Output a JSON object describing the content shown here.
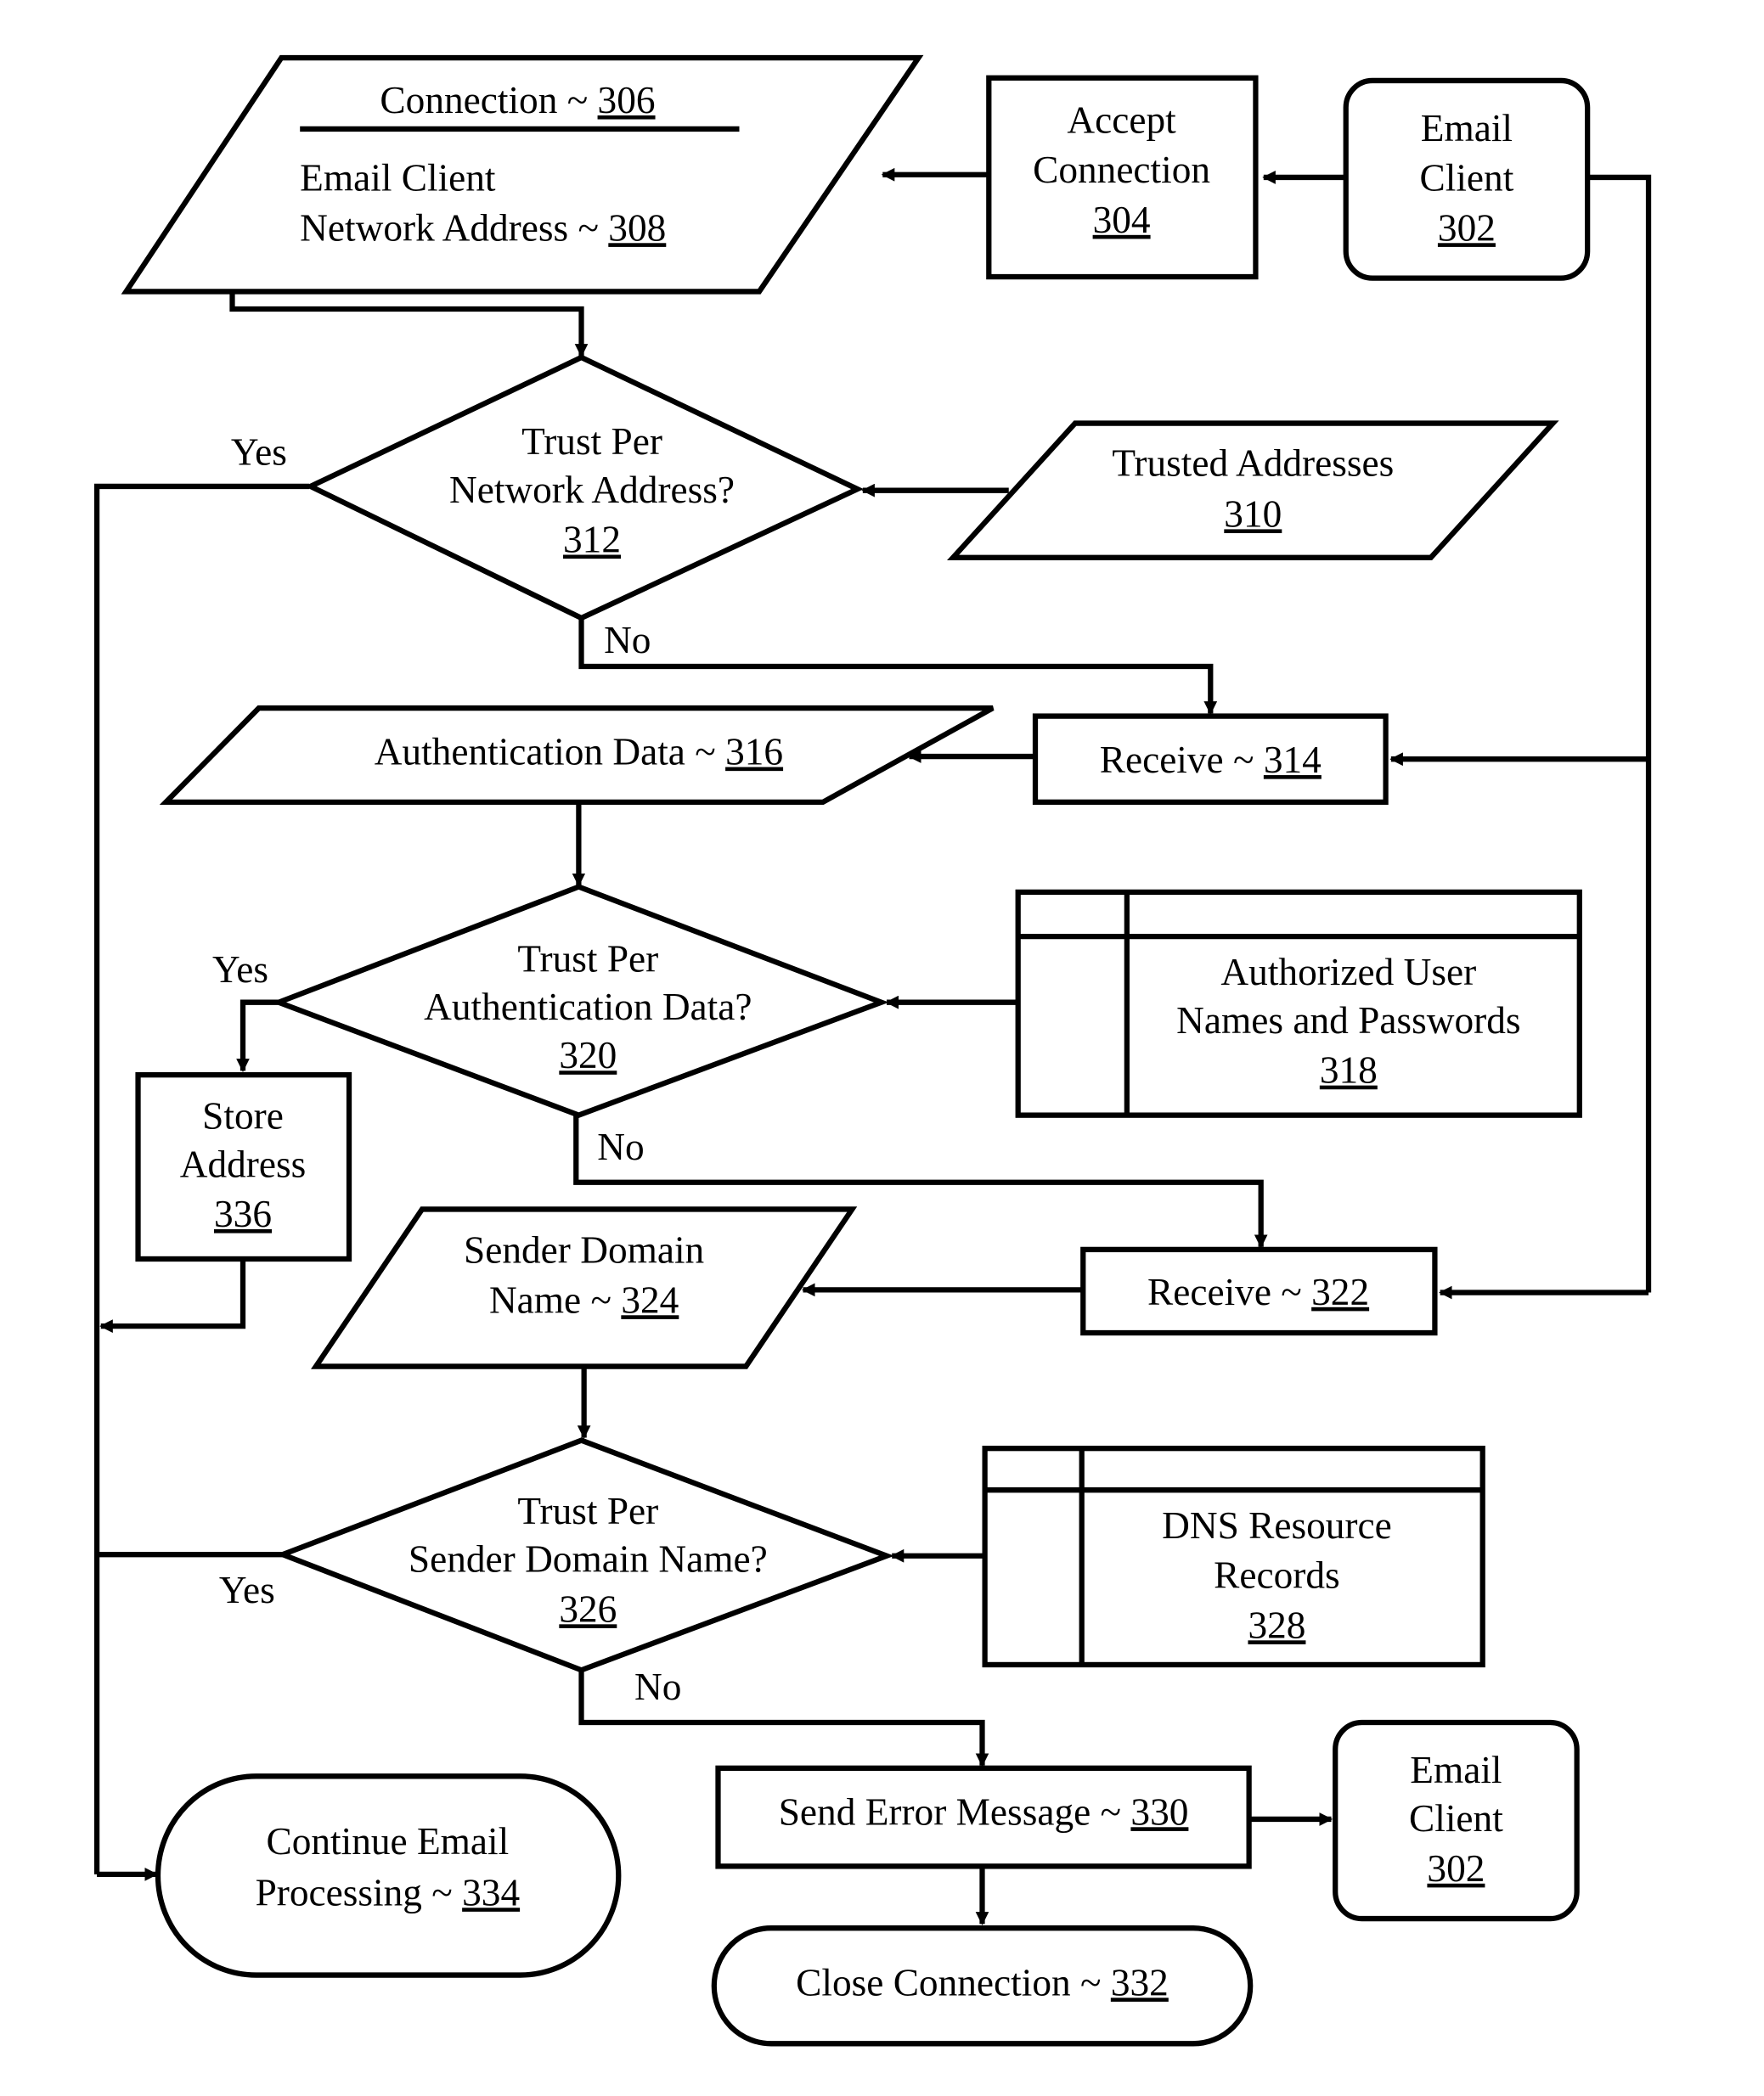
{
  "diagram": {
    "nodes": {
      "connection": {
        "title": "Connection ~ ",
        "title_ref": "306",
        "line1": "Email Client",
        "line2": "Network Address ~ ",
        "ref2": "308"
      },
      "accept": {
        "lines": [
          "Accept",
          "Connection"
        ],
        "ref": "304"
      },
      "email_client_top": {
        "lines": [
          "Email",
          "Client"
        ],
        "ref": "302"
      },
      "trust_network": {
        "lines": [
          "Trust Per",
          "Network Address?"
        ],
        "ref": "312"
      },
      "trusted_addresses": {
        "lines": [
          "Trusted Addresses"
        ],
        "ref": "310"
      },
      "receive_314": {
        "text": "Receive ~ ",
        "ref": "314"
      },
      "auth_data": {
        "text": "Authentication Data ~ ",
        "ref": "316"
      },
      "trust_auth": {
        "lines": [
          "Trust Per",
          "Authentication Data?"
        ],
        "ref": "320"
      },
      "authorized_users": {
        "lines": [
          "Authorized User",
          "Names and Passwords"
        ],
        "ref": "318"
      },
      "store_address": {
        "lines": [
          "Store",
          "Address"
        ],
        "ref": "336"
      },
      "sender_domain": {
        "lines": [
          "Sender Domain",
          "Name ~ "
        ],
        "ref": "324"
      },
      "receive_322": {
        "text": "Receive ~ ",
        "ref": "322"
      },
      "trust_sender": {
        "lines": [
          "Trust Per",
          "Sender Domain Name?"
        ],
        "ref": "326"
      },
      "dns_records": {
        "lines": [
          "DNS Resource",
          "Records"
        ],
        "ref": "328"
      },
      "send_error": {
        "text": "Send Error Message ~ ",
        "ref": "330"
      },
      "email_client_bottom": {
        "lines": [
          "Email",
          "Client"
        ],
        "ref": "302"
      },
      "continue": {
        "lines": [
          "Continue Email",
          "Processing ~ "
        ],
        "ref": "334"
      },
      "close": {
        "text": "Close Connection ~ ",
        "ref": "332"
      }
    },
    "labels": {
      "yes": "Yes",
      "no": "No"
    }
  }
}
